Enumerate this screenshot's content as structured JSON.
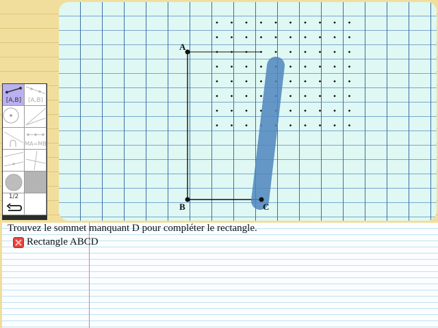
{
  "instruction": "Trouvez le sommet manquant D pour compléter le rectangle.",
  "task": {
    "label": "Rectangle ABCD",
    "status_icon": "cross-icon",
    "status_color": "#e8433a"
  },
  "points": {
    "a": "A",
    "b": "B",
    "c": "C"
  },
  "palette": {
    "segment_tool_label": "[A,B]",
    "line_tool_label": "(A,B)",
    "midpoint_tool_label": "MA=MB",
    "page_indicator": "1/2",
    "selected_color": "#b9b1f0"
  },
  "colors": {
    "canvas_bg": "#dff8f3",
    "grid_major": "#3b6fa6",
    "highlight_stroke": "#4f86bd",
    "margin_line": "#e57b86"
  }
}
